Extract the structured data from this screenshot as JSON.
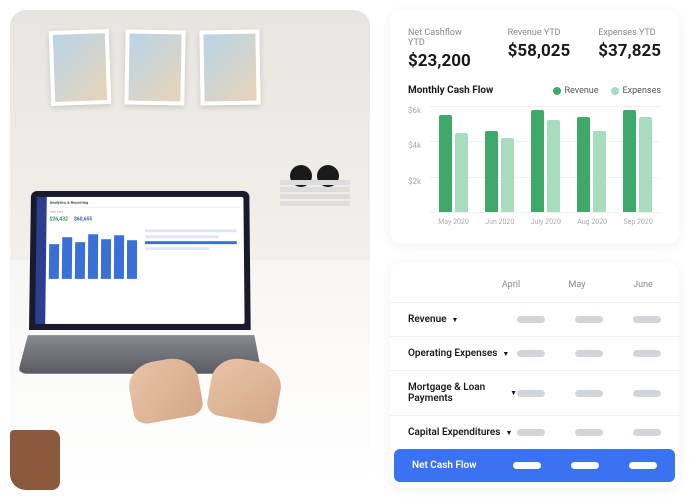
{
  "laptop": {
    "title": "Analytics & Reporting",
    "value1": "$26,432",
    "value2": "$60,655",
    "label1": "Cash Flow"
  },
  "stats": [
    {
      "label": "Net Cashflow YTD",
      "value": "$23,200"
    },
    {
      "label": "Revenue YTD",
      "value": "$58,025"
    },
    {
      "label": "Expenses YTD",
      "value": "$37,825"
    }
  ],
  "chart_title": "Monthly Cash Flow",
  "legend": [
    {
      "label": "Revenue",
      "color": "#3fa86b"
    },
    {
      "label": "Expenses",
      "color": "#a8dcbf"
    }
  ],
  "chart_data": {
    "type": "bar",
    "title": "Monthly Cash Flow",
    "xlabel": "",
    "ylabel": "",
    "ylim": [
      0,
      6000
    ],
    "yticks": [
      "$6k",
      "$4k",
      "$2k"
    ],
    "categories": [
      "May 2020",
      "Jun 2020",
      "July 2020",
      "Aug 2020",
      "Sep 2020"
    ],
    "series": [
      {
        "name": "Revenue",
        "color": "#3fa86b",
        "values": [
          5500,
          4600,
          5800,
          5400,
          5800
        ]
      },
      {
        "name": "Expenses",
        "color": "#a8dcbf",
        "values": [
          4500,
          4200,
          5200,
          4600,
          5400
        ]
      }
    ]
  },
  "table": {
    "columns": [
      "April",
      "May",
      "June"
    ],
    "rows": [
      {
        "label": "Revenue",
        "expandable": true,
        "active": false
      },
      {
        "label": "Operating Expenses",
        "expandable": true,
        "active": false
      },
      {
        "label": "Mortgage & Loan Payments",
        "expandable": true,
        "active": false
      },
      {
        "label": "Capital Expenditures",
        "expandable": true,
        "active": false
      },
      {
        "label": "Net Cash Flow",
        "expandable": false,
        "active": true
      }
    ]
  }
}
